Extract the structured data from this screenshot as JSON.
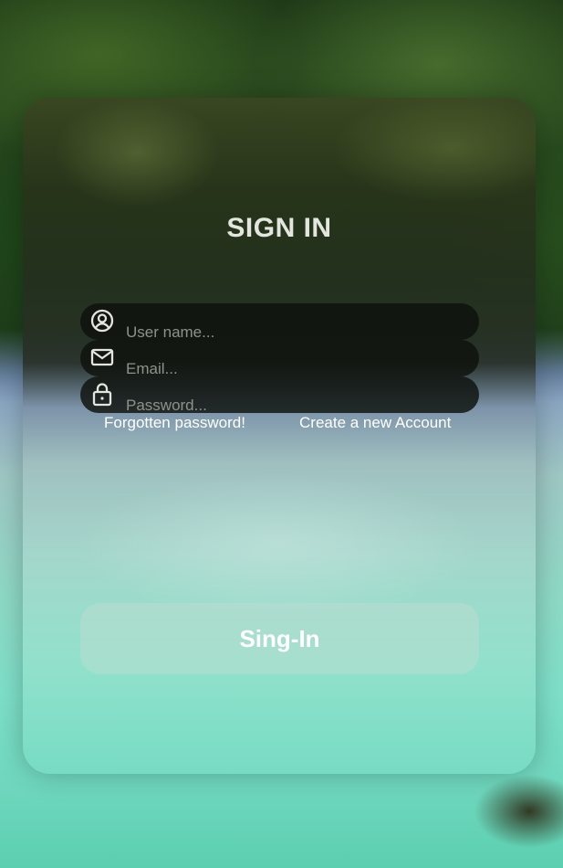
{
  "form": {
    "title": "SIGN IN",
    "fields": [
      {
        "name": "username",
        "icon": "user-circle-icon",
        "placeholder": "User name...",
        "value": ""
      },
      {
        "name": "email",
        "icon": "envelope-icon",
        "placeholder": "Email...",
        "value": ""
      },
      {
        "name": "password",
        "icon": "lock-icon",
        "placeholder": "Password...",
        "value": ""
      }
    ],
    "forgot_link": "Forgotten password!",
    "create_link": "Create a new Account",
    "submit_label": "Sing-In"
  },
  "colors": {
    "title": "#e3e6df",
    "field_bg": "#0e110c",
    "placeholder": "#8d928a",
    "link": "#ffffff"
  }
}
